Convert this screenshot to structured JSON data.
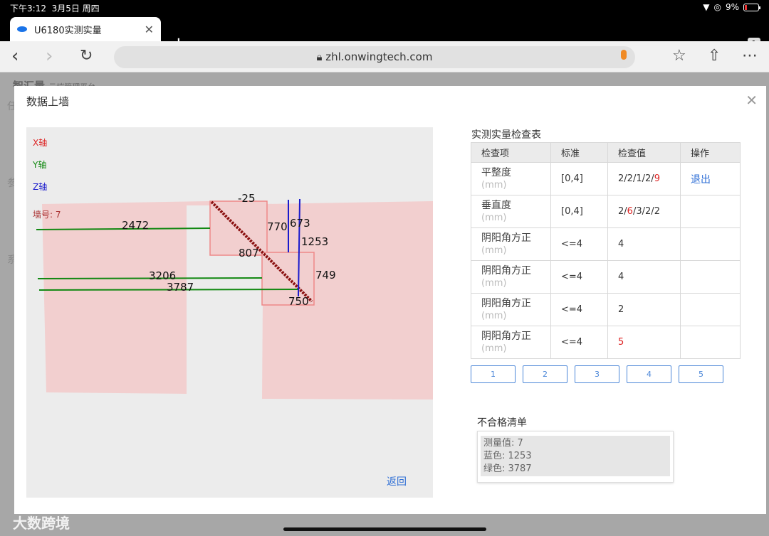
{
  "status": {
    "time": "下午3:12",
    "date": "3月5日 周四",
    "battery": "9%"
  },
  "browser": {
    "tab_title": "U6180实测实量",
    "tab_count": "1",
    "url": "zhl.onwingtech.com"
  },
  "background": {
    "logo": "智汇量",
    "subtitle": "云端管理平台",
    "side_letters": [
      "任",
      "参",
      "系"
    ]
  },
  "modal": {
    "title": "数据上墙",
    "legend": {
      "x": "X轴",
      "y": "Y轴",
      "z": "Z轴",
      "wall": "墙号: 7"
    },
    "drawing_labels": {
      "l_neg25": "-25",
      "l_2472": "2472",
      "l_770": "770",
      "l_673": "673",
      "l_1253": "1253",
      "l_807": "807",
      "l_3206": "3206",
      "l_749": "749",
      "l_3787": "3787",
      "l_750": "750"
    },
    "back_label": "返回",
    "table": {
      "title": "实测实量检查表",
      "headers": [
        "检查项",
        "标准",
        "检查值",
        "操作"
      ],
      "rows": [
        {
          "name": "平整度",
          "unit": "(mm)",
          "standard": "[0,4]",
          "values": [
            {
              "v": "2",
              "red": false
            },
            {
              "v": "/",
              "red": false
            },
            {
              "v": "2",
              "red": false
            },
            {
              "v": "/",
              "red": false
            },
            {
              "v": "1",
              "red": false
            },
            {
              "v": "/",
              "red": false
            },
            {
              "v": "2",
              "red": false
            },
            {
              "v": "/",
              "red": false
            },
            {
              "v": "9",
              "red": true
            }
          ],
          "action": "退出"
        },
        {
          "name": "垂直度",
          "unit": "(mm)",
          "standard": "[0,4]",
          "values": [
            {
              "v": "2",
              "red": false
            },
            {
              "v": "/",
              "red": false
            },
            {
              "v": "6",
              "red": true
            },
            {
              "v": "/",
              "red": false
            },
            {
              "v": "3",
              "red": false
            },
            {
              "v": "/",
              "red": false
            },
            {
              "v": "2",
              "red": false
            },
            {
              "v": "/",
              "red": false
            },
            {
              "v": "2",
              "red": false
            }
          ],
          "action": ""
        },
        {
          "name": "阴阳角方正",
          "unit": "(mm)",
          "standard": "<=4",
          "values": [
            {
              "v": "4",
              "red": false
            }
          ],
          "action": ""
        },
        {
          "name": "阴阳角方正",
          "unit": "(mm)",
          "standard": "<=4",
          "values": [
            {
              "v": "4",
              "red": false
            }
          ],
          "action": ""
        },
        {
          "name": "阴阳角方正",
          "unit": "(mm)",
          "standard": "<=4",
          "values": [
            {
              "v": "2",
              "red": false
            }
          ],
          "action": ""
        },
        {
          "name": "阴阳角方正",
          "unit": "(mm)",
          "standard": "<=4",
          "values": [
            {
              "v": "5",
              "red": true
            }
          ],
          "action": ""
        }
      ]
    },
    "pager": [
      "1",
      "2",
      "3",
      "4",
      "5"
    ],
    "fail_list": {
      "title": "不合格清单",
      "lines": [
        "测量值: 7",
        "蓝色: 1253",
        "绿色: 3787"
      ]
    }
  },
  "watermark": "大数跨境",
  "colors": {
    "accent": "#2f6fd6",
    "fail_red": "#d22",
    "wall_fill": "#f2cfcf"
  }
}
